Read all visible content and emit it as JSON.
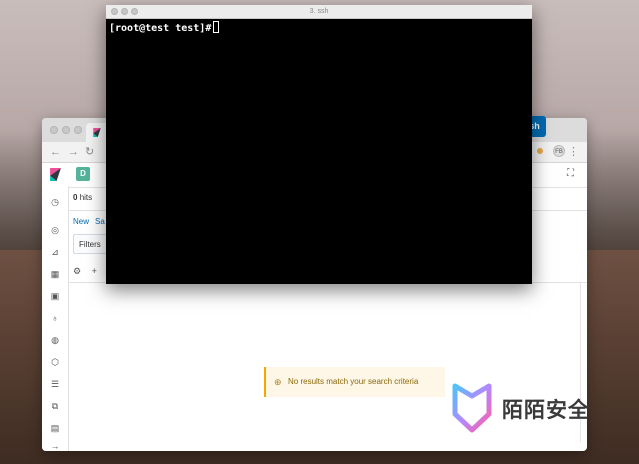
{
  "terminal": {
    "title": "3. ssh",
    "prompt": "[root@test test]#"
  },
  "browser": {
    "hits_count": "0",
    "hits_label": "hits",
    "space_badge": "D",
    "menu": [
      "New",
      "Sa"
    ],
    "filters_label": "Filters",
    "refresh_label": "Refresh",
    "no_results_text": "No results match your search criteria",
    "profile_initials": "FB"
  },
  "watermark": {
    "text": "陌陌安全"
  },
  "colors": {
    "accent": "#006bb4",
    "warning_border": "#f5a700",
    "space_badge": "#54b399"
  }
}
